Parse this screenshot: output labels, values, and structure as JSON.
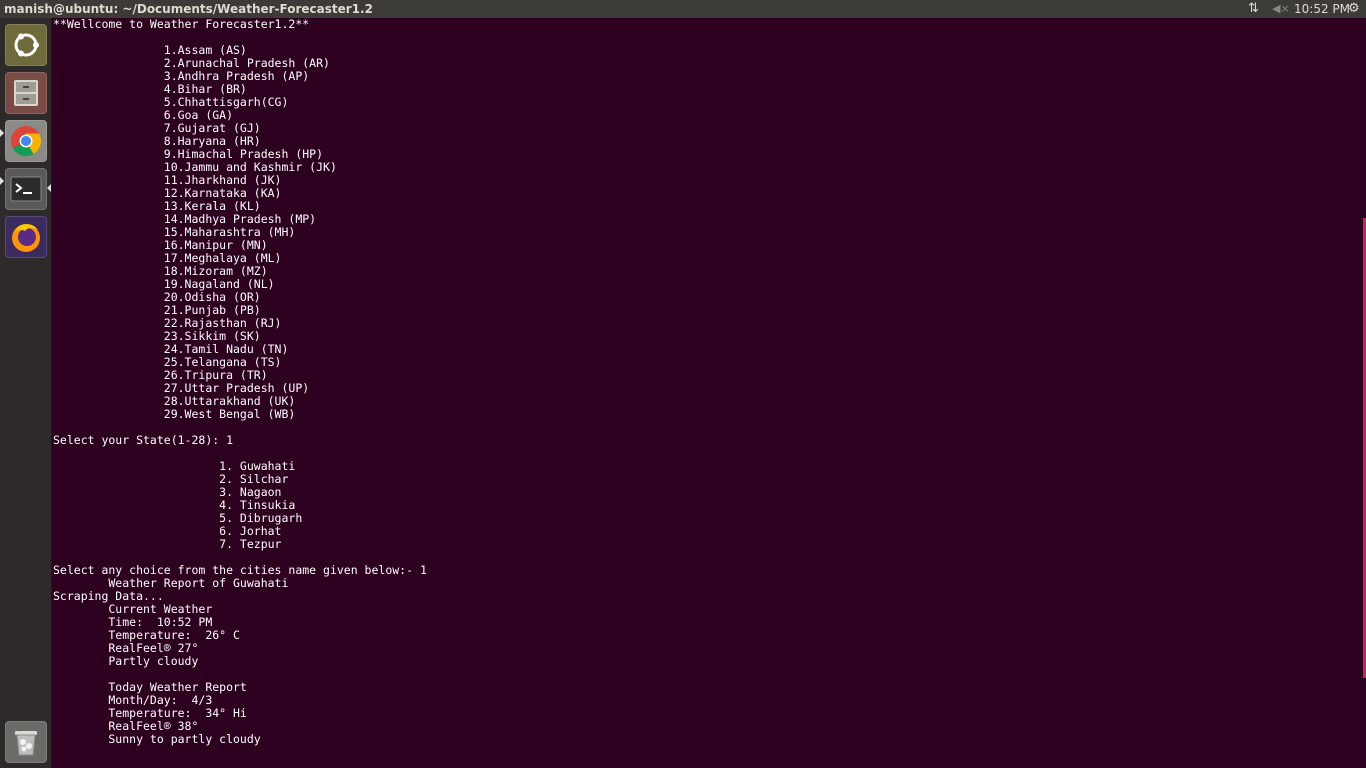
{
  "topbar": {
    "window_title": "manish@ubuntu: ~/Documents/Weather-Forecaster1.2",
    "clock": "10:52 PM",
    "network_icon": "network-arrows-icon",
    "volume_icon": "volume-muted-icon",
    "settings_icon": "gear-icon"
  },
  "launcher": {
    "items": [
      {
        "name": "Ubuntu Dash",
        "icon": "ubuntu-logo-icon"
      },
      {
        "name": "Files",
        "icon": "files-cabinet-icon"
      },
      {
        "name": "Google Chrome",
        "icon": "chrome-icon"
      },
      {
        "name": "Terminal",
        "icon": "terminal-icon"
      },
      {
        "name": "Firefox",
        "icon": "firefox-icon"
      },
      {
        "name": "Trash",
        "icon": "trash-icon"
      }
    ]
  },
  "terminal": {
    "lines": [
      "**Wellcome to Weather Forecaster1.2**",
      "",
      "\t\t1.Assam (AS)",
      "\t\t2.Arunachal Pradesh (AR)",
      "\t\t3.Andhra Pradesh (AP)",
      "\t\t4.Bihar (BR)",
      "\t\t5.Chhattisgarh(CG)",
      "\t\t6.Goa (GA)",
      "\t\t7.Gujarat (GJ)",
      "\t\t8.Haryana (HR)",
      "\t\t9.Himachal Pradesh (HP)",
      "\t\t10.Jammu and Kashmir (JK)",
      "\t\t11.Jharkhand (JK)",
      "\t\t12.Karnataka (KA)",
      "\t\t13.Kerala (KL)",
      "\t\t14.Madhya Pradesh (MP)",
      "\t\t15.Maharashtra (MH)",
      "\t\t16.Manipur (MN)",
      "\t\t17.Meghalaya (ML)",
      "\t\t18.Mizoram (MZ)",
      "\t\t19.Nagaland (NL)",
      "\t\t20.Odisha (OR)",
      "\t\t21.Punjab (PB)",
      "\t\t22.Rajasthan (RJ)",
      "\t\t23.Sikkim (SK)",
      "\t\t24.Tamil Nadu (TN)",
      "\t\t25.Telangana (TS)",
      "\t\t26.Tripura (TR)",
      "\t\t27.Uttar Pradesh (UP)",
      "\t\t28.Uttarakhand (UK)",
      "\t\t29.West Bengal (WB)",
      "",
      "Select your State(1-28): 1",
      "",
      "\t\t\t1. Guwahati",
      "\t\t\t2. Silchar",
      "\t\t\t3. Nagaon",
      "\t\t\t4. Tinsukia",
      "\t\t\t5. Dibrugarh",
      "\t\t\t6. Jorhat",
      "\t\t\t7. Tezpur",
      "",
      "Select any choice from the cities name given below:- 1",
      "\tWeather Report of Guwahati",
      "Scraping Data...",
      "\tCurrent Weather",
      "\tTime:  10:52 PM",
      "\tTemperature:  26° C",
      "\tRealFeel® 27°",
      "\tPartly cloudy",
      "",
      "\tToday Weather Report",
      "\tMonth/Day:  4/3",
      "\tTemperature:  34° Hi",
      "\tRealFeel® 38°",
      "\tSunny to partly cloudy"
    ]
  }
}
